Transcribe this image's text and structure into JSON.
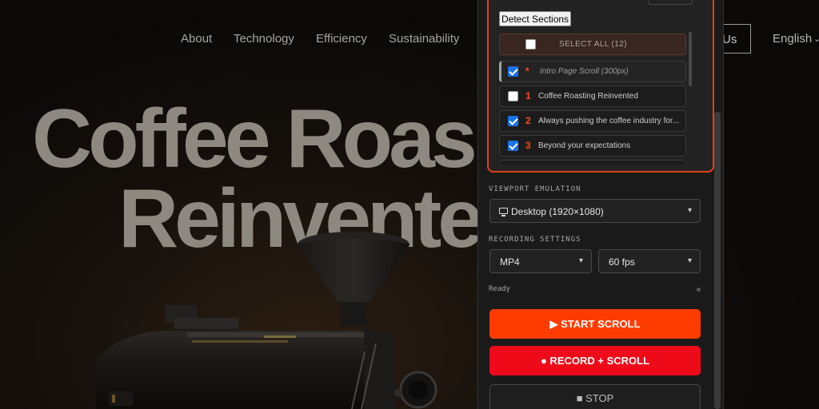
{
  "site": {
    "nav": [
      "About",
      "Technology",
      "Efficiency",
      "Sustainability"
    ],
    "contact_label": "Us",
    "language": "English",
    "hero_line1": "Coffee Roas",
    "hero_line2": "Reinvente"
  },
  "panel": {
    "top_partial_label": "",
    "detect_button": "Detect Sections",
    "select_all_label": "SELECT ALL (12)",
    "sections": [
      {
        "num": "*",
        "title": "Intro Page Scroll (300px)",
        "checked": true
      },
      {
        "num": "1",
        "title": "Coffee Roasting Reinvented",
        "checked": false
      },
      {
        "num": "2",
        "title": "Always pushing the coffee industry for...",
        "checked": true
      },
      {
        "num": "3",
        "title": "Beyond your expectations",
        "checked": true
      }
    ],
    "viewport_label": "VIEWPORT EMULATION",
    "viewport_value": "Desktop (1920×1080)",
    "recording_label": "RECORDING SETTINGS",
    "format_value": "MP4",
    "fps_value": "60 fps",
    "status": "Ready",
    "start_button": "▶ START SCROLL",
    "record_button": "● RECORD + SCROLL",
    "stop_button": "■ STOP"
  },
  "colors": {
    "accent": "#ff3c00",
    "record": "#ef0a1a",
    "checkbox": "#1a73e8"
  }
}
